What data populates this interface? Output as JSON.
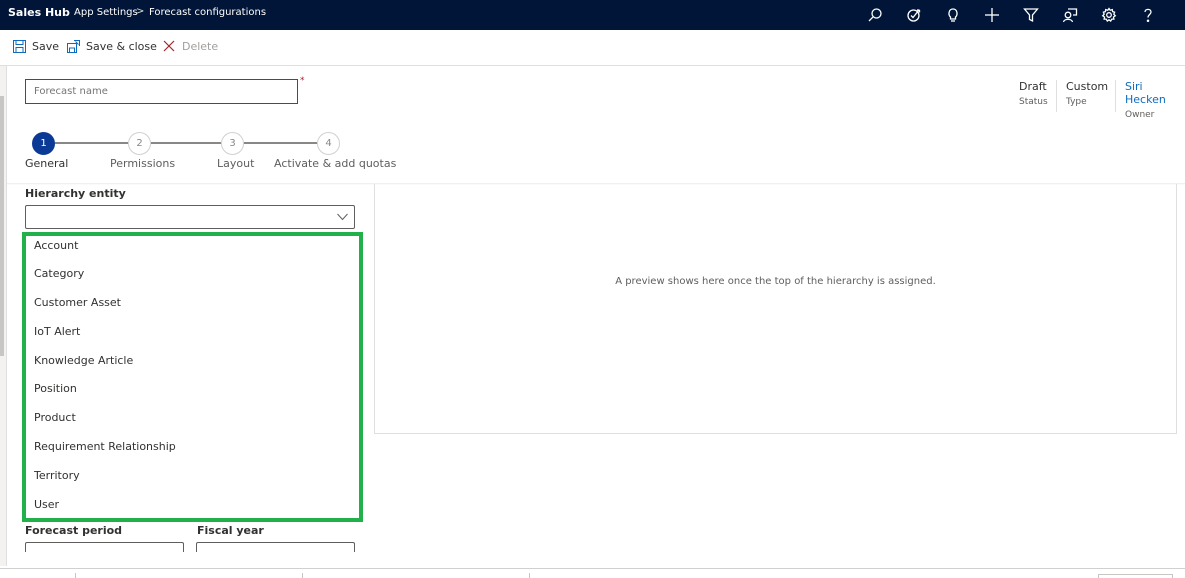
{
  "topbar": {
    "app_name": "Sales Hub",
    "breadcrumb": [
      "App Settings",
      "Forecast configurations"
    ],
    "icons": [
      "search-icon",
      "target-icon",
      "lightbulb-icon",
      "plus-icon",
      "filter-icon",
      "assistant-icon",
      "gear-icon",
      "help-icon"
    ]
  },
  "commandbar": {
    "save_label": "Save",
    "save_close_label": "Save & close",
    "delete_label": "Delete"
  },
  "form": {
    "name_placeholder": "Forecast name",
    "required_marker": "*",
    "meta": [
      {
        "value": "Draft",
        "label": "Status"
      },
      {
        "value": "Custom",
        "label": "Type"
      },
      {
        "value": "Siri Hecken",
        "label": "Owner"
      }
    ]
  },
  "stepper": {
    "steps": [
      {
        "number": "1",
        "label": "General",
        "active": true
      },
      {
        "number": "2",
        "label": "Permissions",
        "active": false
      },
      {
        "number": "3",
        "label": "Layout",
        "active": false
      },
      {
        "number": "4",
        "label": "Activate & add quotas",
        "active": false
      }
    ]
  },
  "general": {
    "hierarchy_label": "Hierarchy entity",
    "hierarchy_value": "",
    "options": [
      "Account",
      "Category",
      "Customer Asset",
      "IoT Alert",
      "Knowledge Article",
      "Position",
      "Product",
      "Requirement Relationship",
      "Territory",
      "User"
    ],
    "forecast_period_label": "Forecast period",
    "fiscal_year_label": "Fiscal year"
  },
  "preview": {
    "message": "A preview shows here once the top of the hierarchy is assigned."
  },
  "colors": {
    "topbar_bg": "#001537",
    "active_step": "#0b3a96",
    "highlight": "#22b04b",
    "required": "#a4262c",
    "link": "#0f6cbd"
  }
}
